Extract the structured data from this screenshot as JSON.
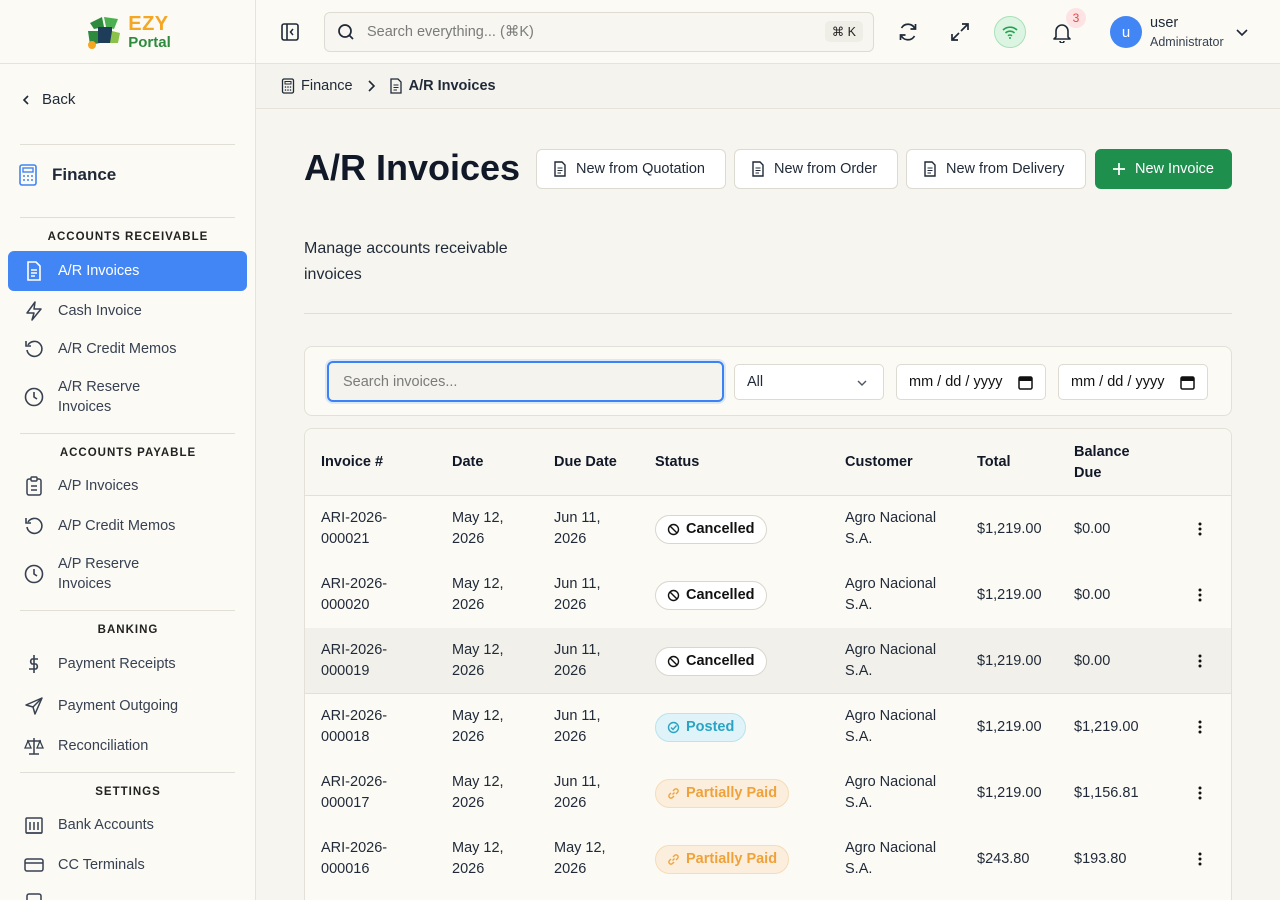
{
  "brand": {
    "line1": "EZY",
    "line2": "Portal"
  },
  "sidebar": {
    "back_label": "Back",
    "module_title": "Finance",
    "sections": [
      {
        "label": "ACCOUNTS RECEIVABLE"
      },
      {
        "label": "ACCOUNTS PAYABLE"
      },
      {
        "label": "BANKING"
      },
      {
        "label": "SETTINGS"
      }
    ],
    "items": [
      {
        "label": "A/R Invoices",
        "icon": "document-icon",
        "active": true
      },
      {
        "label": "Cash Invoice",
        "icon": "lightning-icon"
      },
      {
        "label": "A/R Credit Memos",
        "icon": "undo-icon"
      },
      {
        "label": "A/R Reserve Invoices",
        "icon": "clock-icon"
      },
      {
        "label": "A/P Invoices",
        "icon": "clipboard-icon"
      },
      {
        "label": "A/P Credit Memos",
        "icon": "undo-icon"
      },
      {
        "label": "A/P Reserve Invoices",
        "icon": "clock-icon"
      },
      {
        "label": "Payment Receipts",
        "icon": "dollar-icon"
      },
      {
        "label": "Payment Outgoing",
        "icon": "send-icon"
      },
      {
        "label": "Reconciliation",
        "icon": "scale-icon"
      },
      {
        "label": "Bank Accounts",
        "icon": "bank-icon"
      },
      {
        "label": "CC Terminals",
        "icon": "card-icon"
      }
    ]
  },
  "topbar": {
    "search_placeholder": "Search everything... (⌘K)",
    "search_shortcut": "⌘ K",
    "notification_count": "3",
    "user_initial": "u",
    "user_name": "user",
    "user_role": "Administrator"
  },
  "breadcrumb": {
    "parent": "Finance",
    "current": "A/R Invoices"
  },
  "page": {
    "title": "A/R Invoices",
    "subtitle": "Manage accounts receivable invoices",
    "actions": {
      "from_quotation": "New from Quotation",
      "from_order": "New from Order",
      "from_delivery": "New from Delivery",
      "new_invoice": "New Invoice"
    }
  },
  "filters": {
    "search_placeholder": "Search invoices...",
    "status_value": "All",
    "date_from_placeholder": "mm / dd / yyyy",
    "date_to_placeholder": "mm / dd / yyyy"
  },
  "table": {
    "columns": [
      "Invoice #",
      "Date",
      "Due Date",
      "Status",
      "Customer",
      "Total",
      "Balance Due"
    ],
    "rows": [
      {
        "invoice": "ARI-2026-000021",
        "date": "May 12, 2026",
        "due": "Jun 11, 2026",
        "status": "Cancelled",
        "customer": "Agro Nacional S.A.",
        "total": "$1,219.00",
        "balance": "$0.00"
      },
      {
        "invoice": "ARI-2026-000020",
        "date": "May 12, 2026",
        "due": "Jun 11, 2026",
        "status": "Cancelled",
        "customer": "Agro Nacional S.A.",
        "total": "$1,219.00",
        "balance": "$0.00"
      },
      {
        "invoice": "ARI-2026-000019",
        "date": "May 12, 2026",
        "due": "Jun 11, 2026",
        "status": "Cancelled",
        "customer": "Agro Nacional S.A.",
        "total": "$1,219.00",
        "balance": "$0.00"
      },
      {
        "invoice": "ARI-2026-000018",
        "date": "May 12, 2026",
        "due": "Jun 11, 2026",
        "status": "Posted",
        "customer": "Agro Nacional S.A.",
        "total": "$1,219.00",
        "balance": "$1,219.00"
      },
      {
        "invoice": "ARI-2026-000017",
        "date": "May 12, 2026",
        "due": "Jun 11, 2026",
        "status": "Partially Paid",
        "customer": "Agro Nacional S.A.",
        "total": "$1,219.00",
        "balance": "$1,156.81"
      },
      {
        "invoice": "ARI-2026-000016",
        "date": "May 12, 2026",
        "due": "May 12, 2026",
        "status": "Partially Paid",
        "customer": "Agro Nacional S.A.",
        "total": "$243.80",
        "balance": "$193.80"
      }
    ]
  },
  "colors": {
    "accent": "#4285f4",
    "primary_button": "#1f8f4e",
    "posted": "#2ba4c4",
    "partial": "#f0a23a"
  }
}
